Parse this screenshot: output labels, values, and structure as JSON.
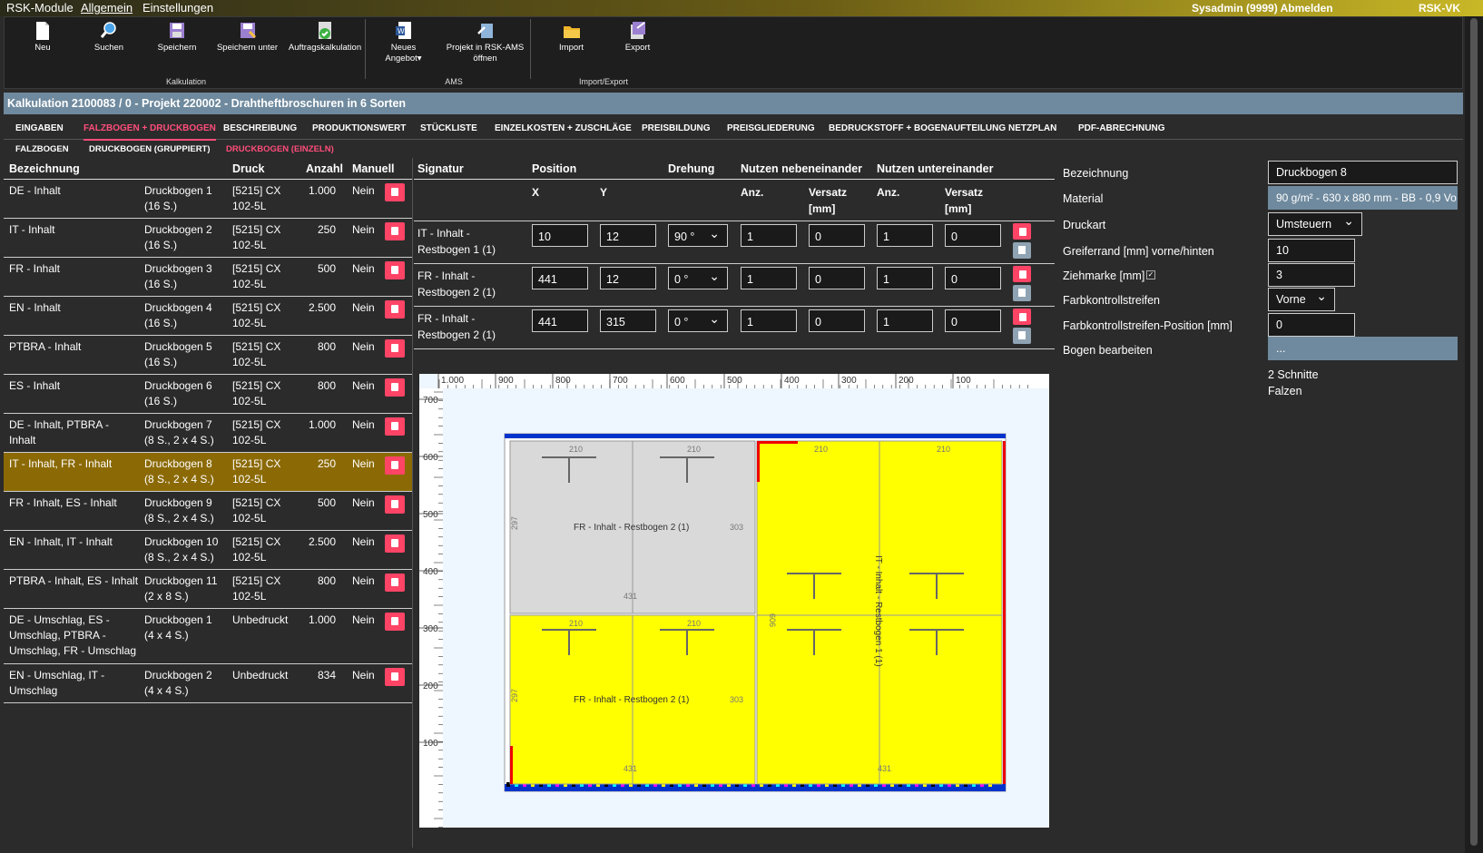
{
  "topbar": {
    "menu": [
      "RSK-Module",
      "Allgemein",
      "Einstellungen"
    ],
    "user": "Sysadmin (9999) Abmelden",
    "app": "RSK-VK"
  },
  "ribbon": {
    "buttons": [
      "Neu",
      "Suchen",
      "Speichern",
      "Speichern unter",
      "Auftragskalkulation",
      "Neues Angebot▾",
      "Projekt in RSK-AMS öffnen",
      "Import",
      "Export"
    ],
    "groups": [
      "Kalkulation",
      "AMS",
      "Import/Export"
    ]
  },
  "title": "Kalkulation 2100083 / 0 - Projekt 220002 - Drahtheftbroschuren in 6 Sorten",
  "tabs": [
    "EINGABEN",
    "FALZBOGEN + DRUCKBOGEN",
    "BESCHREIBUNG",
    "PRODUKTIONSWERT",
    "STÜCKLISTE",
    "EINZELKOSTEN + ZUSCHLÄGE",
    "PREISBILDUNG",
    "PREISGLIEDERUNG",
    "BEDRUCKSTOFF + BOGENAUFTEILUNG",
    "NETZPLAN",
    "PDF-ABRECHNUNG"
  ],
  "subtabs": [
    "FALZBOGEN",
    "DRUCKBOGEN (GRUPPIERT)",
    "DRUCKBOGEN (EINZELN)"
  ],
  "left": {
    "headers": [
      "Bezeichnung",
      "Druck",
      "Anzahl",
      "Manuell"
    ],
    "rows": [
      {
        "name": "DE - Inhalt",
        "bogen": "Druckbogen 1",
        "sub": "(16 S.)",
        "druck": "[5215] CX",
        "druck2": "102-5L",
        "anzahl": "1.000",
        "manuell": "Nein"
      },
      {
        "name": "IT - Inhalt",
        "bogen": "Druckbogen 2",
        "sub": "(16 S.)",
        "druck": "[5215] CX",
        "druck2": "102-5L",
        "anzahl": "250",
        "manuell": "Nein"
      },
      {
        "name": "FR - Inhalt",
        "bogen": "Druckbogen 3",
        "sub": "(16 S.)",
        "druck": "[5215] CX",
        "druck2": "102-5L",
        "anzahl": "500",
        "manuell": "Nein"
      },
      {
        "name": "EN - Inhalt",
        "bogen": "Druckbogen 4",
        "sub": "(16 S.)",
        "druck": "[5215] CX",
        "druck2": "102-5L",
        "anzahl": "2.500",
        "manuell": "Nein"
      },
      {
        "name": "PTBRA - Inhalt",
        "bogen": "Druckbogen 5",
        "sub": "(16 S.)",
        "druck": "[5215] CX",
        "druck2": "102-5L",
        "anzahl": "800",
        "manuell": "Nein"
      },
      {
        "name": "ES - Inhalt",
        "bogen": "Druckbogen 6",
        "sub": "(16 S.)",
        "druck": "[5215] CX",
        "druck2": "102-5L",
        "anzahl": "800",
        "manuell": "Nein"
      },
      {
        "name": "DE - Inhalt, PTBRA -",
        "name2": "Inhalt",
        "bogen": "Druckbogen 7",
        "sub": "(8 S., 2 x 4 S.)",
        "druck": "[5215] CX",
        "druck2": "102-5L",
        "anzahl": "1.000",
        "manuell": "Nein"
      },
      {
        "name": "IT - Inhalt, FR - Inhalt",
        "bogen": "Druckbogen 8",
        "sub": "(8 S., 2 x 4 S.)",
        "druck": "[5215] CX",
        "druck2": "102-5L",
        "anzahl": "250",
        "manuell": "Nein",
        "selected": true
      },
      {
        "name": "FR - Inhalt, ES - Inhalt",
        "bogen": "Druckbogen 9",
        "sub": "(8 S., 2 x 4 S.)",
        "druck": "[5215] CX",
        "druck2": "102-5L",
        "anzahl": "500",
        "manuell": "Nein"
      },
      {
        "name": "EN - Inhalt, IT - Inhalt",
        "bogen": "Druckbogen 10",
        "sub": "(8 S., 2 x 4 S.)",
        "druck": "[5215] CX",
        "druck2": "102-5L",
        "anzahl": "2.500",
        "manuell": "Nein"
      },
      {
        "name": "PTBRA - Inhalt, ES - Inhalt",
        "bogen": "Druckbogen 11",
        "sub": "(2 x 8 S.)",
        "druck": "[5215] CX",
        "druck2": "102-5L",
        "anzahl": "800",
        "manuell": "Nein"
      },
      {
        "name": "DE - Umschlag, ES -",
        "name2": "Umschlag, PTBRA -",
        "name3": "Umschlag, FR - Umschlag",
        "bogen": "Druckbogen 1",
        "sub": "(4 x 4 S.)",
        "druck": "Unbedruckt",
        "druck2": "",
        "anzahl": "1.000",
        "manuell": "Nein"
      },
      {
        "name": "EN - Umschlag, IT -",
        "name2": "Umschlag",
        "bogen": "Druckbogen 2",
        "sub": "(4 x 4 S.)",
        "druck": "Unbedruckt",
        "druck2": "",
        "anzahl": "834",
        "manuell": "Nein"
      }
    ]
  },
  "middle": {
    "headers": [
      "Signatur",
      "Position",
      "Drehung",
      "Nutzen nebeneinander",
      "Nutzen untereinander"
    ],
    "subheaders": [
      "X",
      "Y",
      "Anz.",
      "Versatz",
      "[mm]",
      "Anz.",
      "Versatz",
      "[mm]"
    ],
    "rows": [
      {
        "sig1": "IT - Inhalt -",
        "sig2": "Restbogen 1 (1)",
        "x": "10",
        "y": "12",
        "dreh": "90 °",
        "nanz": "1",
        "nvers": "0",
        "uanz": "1",
        "uvers": "0"
      },
      {
        "sig1": "FR - Inhalt -",
        "sig2": "Restbogen 2 (1)",
        "x": "441",
        "y": "12",
        "dreh": "0 °",
        "nanz": "1",
        "nvers": "0",
        "uanz": "1",
        "uvers": "0"
      },
      {
        "sig1": "FR - Inhalt -",
        "sig2": "Restbogen 2 (1)",
        "x": "441",
        "y": "315",
        "dreh": "0 °",
        "nanz": "1",
        "nvers": "0",
        "uanz": "1",
        "uvers": "0"
      }
    ]
  },
  "ruler": {
    "top": [
      "1.000",
      "900",
      "800",
      "700",
      "600",
      "500",
      "400",
      "300",
      "200",
      "100"
    ],
    "left": [
      "700",
      "600",
      "500",
      "400",
      "300",
      "200",
      "100"
    ]
  },
  "sheet": {
    "gray_label": "FR - Inhalt - Restbogen 2 (1)",
    "yellow_label": "FR - Inhalt - Restbogen 2 (1)",
    "rot_label": "IT - Inhalt - Restbogen 1 (1)",
    "dims": {
      "w210": "210",
      "h297": "297",
      "h303": "303",
      "w431": "431",
      "v606": "606"
    }
  },
  "right": {
    "labels": [
      "Bezeichnung",
      "Material",
      "Druckart",
      "Greiferrand [mm] vorne/hinten",
      "Ziehmarke [mm]",
      "Farbkontrollstreifen",
      "Farbkontrollstreifen-Position [mm]",
      "Bogen bearbeiten"
    ],
    "bezeichnung": "Druckbogen 8",
    "material": "90 g/m² - 630 x 880 mm - BB - 0,9 Vo",
    "druckart": "Umsteuern",
    "greiferrand": "10",
    "ziehmarke": "3",
    "farbkontroll": "Vorne",
    "fkpos": "0",
    "bogen_btn": "...",
    "info1": "2 Schnitte",
    "info2": "Falzen"
  }
}
